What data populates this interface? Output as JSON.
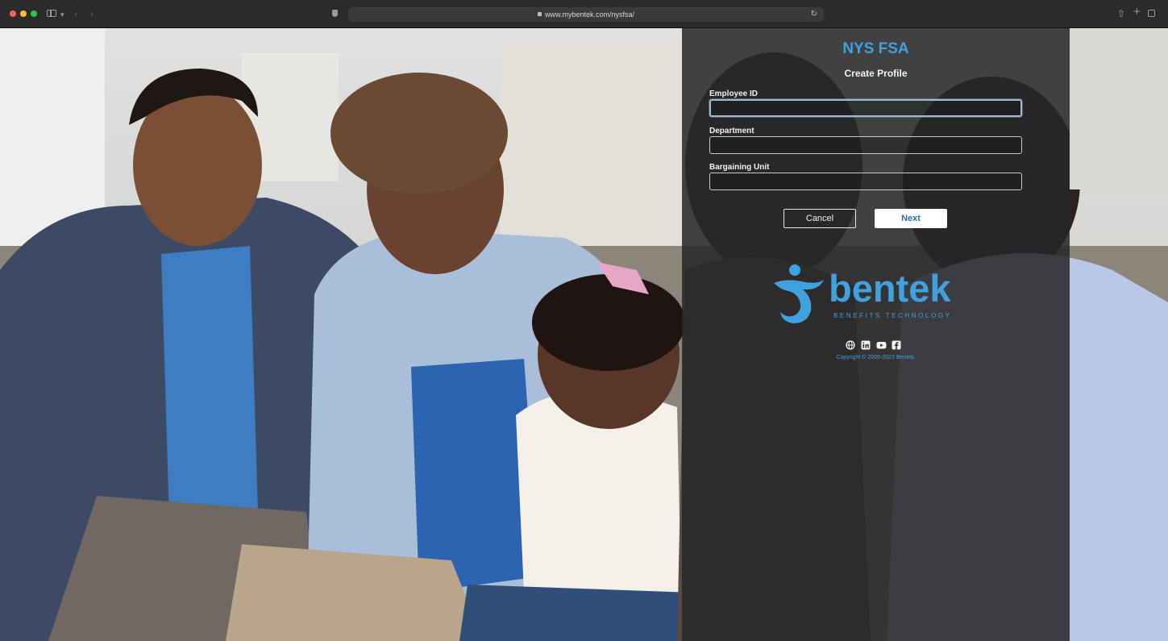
{
  "browser": {
    "url": "www.mybentek.com/nysfsa/"
  },
  "panel": {
    "title": "NYS FSA",
    "subtitle": "Create Profile",
    "fields": [
      {
        "label": "Employee ID",
        "value": ""
      },
      {
        "label": "Department",
        "value": ""
      },
      {
        "label": "Bargaining Unit",
        "value": ""
      }
    ],
    "buttons": {
      "cancel": "Cancel",
      "next": "Next"
    }
  },
  "brand": {
    "name": "bentek",
    "tagline": "BENEFITS TECHNOLOGY",
    "accent_color": "#3fa2de"
  },
  "footer": {
    "social_icons": [
      "globe-icon",
      "linkedin-icon",
      "youtube-icon",
      "facebook-icon"
    ],
    "copyright": "Copyright © 2005-2023 Bentek."
  }
}
